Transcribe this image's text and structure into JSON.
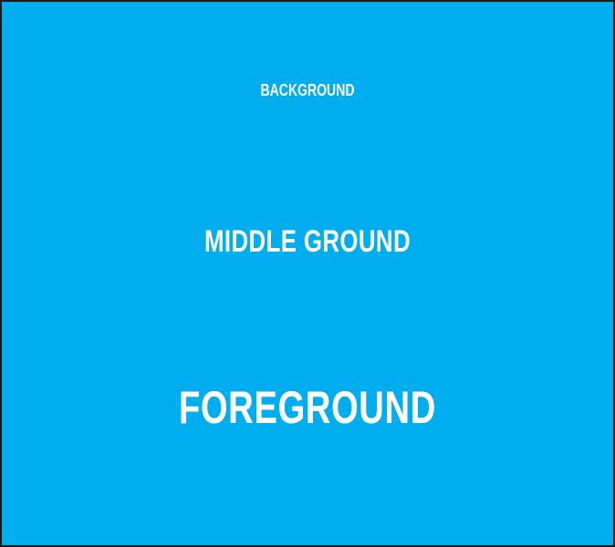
{
  "canvas": {
    "background_color": "#00aeef",
    "text_color": "#ffffff",
    "border_color": "#1a1a1a"
  },
  "labels": {
    "background": "BACKGROUND",
    "middle_ground": "MIDDLE GROUND",
    "foreground": "FOREGROUND"
  }
}
